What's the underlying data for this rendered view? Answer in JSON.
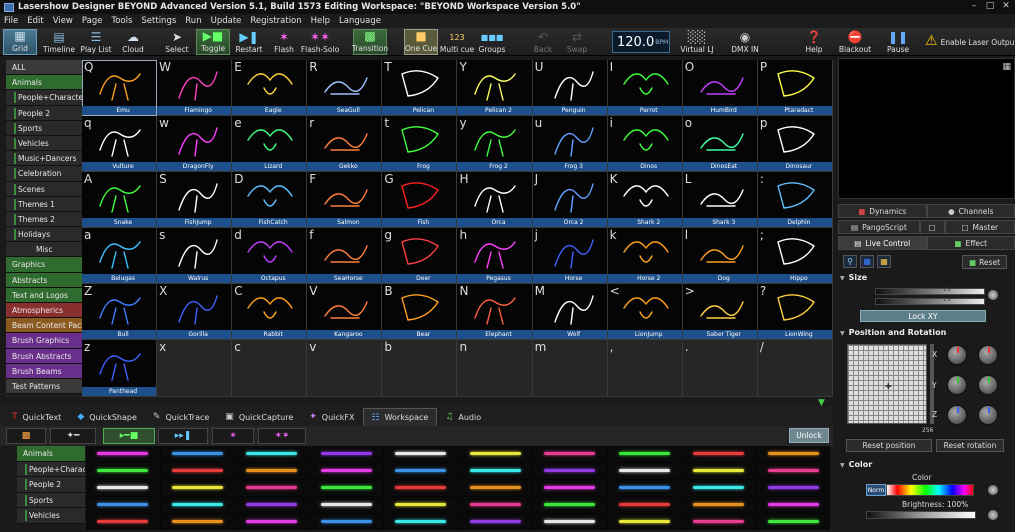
{
  "window": {
    "title": "Lasershow Designer BEYOND Advanced    Version 5.1, Build 1573   Editing Workspace: \"BEYOND Workspace Version 5.0\""
  },
  "menu": [
    "File",
    "Edit",
    "View",
    "Page",
    "Tools",
    "Settings",
    "Run",
    "Update",
    "Registration",
    "Help",
    "Language"
  ],
  "toolbar": {
    "grid": "Grid",
    "timeline": "Timeline",
    "playlist": "Play List",
    "cloud": "Cloud",
    "select": "Select",
    "toggle": "Toggle",
    "restart": "Restart",
    "flash": "Flash",
    "flash_solo": "Flash-Solo",
    "transition": "Transition",
    "one_cue": "One Cue",
    "multi_cue": "Multi cue",
    "groups": "Groups",
    "back": "Back",
    "swap": "Swap",
    "bpm_value": "120.0",
    "bpm_unit": "BPM",
    "virtual_lj": "Virtual LJ",
    "dmx_in": "DMX IN",
    "help": "Help",
    "blackout": "Blackout",
    "pause": "Pause",
    "enable_laser": "Enable Laser Output"
  },
  "categories": [
    {
      "label": "ALL",
      "level": 0,
      "color": "#3a3a3a"
    },
    {
      "label": "Animals",
      "level": 0,
      "color": "#2f6a2f"
    },
    {
      "label": "People+Characters",
      "level": 1
    },
    {
      "label": "People 2",
      "level": 1
    },
    {
      "label": "Sports",
      "level": 1
    },
    {
      "label": "Vehicles",
      "level": 1
    },
    {
      "label": "Music+Dancers",
      "level": 1
    },
    {
      "label": "Celebration",
      "level": 1
    },
    {
      "label": "Scenes",
      "level": 1
    },
    {
      "label": "Themes 1",
      "level": 1
    },
    {
      "label": "Themes 2",
      "level": 1
    },
    {
      "label": "Holidays",
      "level": 1
    },
    {
      "label": "Misc",
      "level": 2
    },
    {
      "label": "Graphics",
      "level": 0,
      "color": "#2f6a2f"
    },
    {
      "label": "Abstracts",
      "level": 0,
      "color": "#2f6a2f"
    },
    {
      "label": "Text and Logos",
      "level": 0,
      "color": "#2f6a2f"
    },
    {
      "label": "Atmospherics",
      "level": 0,
      "color": "#8a2f2f"
    },
    {
      "label": "Beam Content Pack",
      "level": 0,
      "color": "#8a5a1f"
    },
    {
      "label": "Brush Graphics",
      "level": 0,
      "color": "#6a2f8a"
    },
    {
      "label": "Brush Abstracts",
      "level": 0,
      "color": "#6a2f8a"
    },
    {
      "label": "Brush Beams",
      "level": 0,
      "color": "#6a2f8a"
    },
    {
      "label": "Test Patterns",
      "level": 0,
      "color": "#3a3a3a"
    }
  ],
  "cues": [
    {
      "key": "Q",
      "name": "Emu",
      "c": "#ffa020"
    },
    {
      "key": "W",
      "name": "Flamingo",
      "c": "#ff40c0"
    },
    {
      "key": "E",
      "name": "Eagle",
      "c": "#ffd040"
    },
    {
      "key": "R",
      "name": "SeaGull",
      "c": "#a0c0ff"
    },
    {
      "key": "T",
      "name": "Pelican",
      "c": "#ffffff"
    },
    {
      "key": "Y",
      "name": "Pelican 2",
      "c": "#ffff60"
    },
    {
      "key": "U",
      "name": "Penguin",
      "c": "#ffffff"
    },
    {
      "key": "I",
      "name": "Parrot",
      "c": "#40ff40"
    },
    {
      "key": "O",
      "name": "HumBird",
      "c": "#c040ff"
    },
    {
      "key": "P",
      "name": "Ptaradact",
      "c": "#ffff40"
    },
    {
      "key": "q",
      "name": "Vulture",
      "c": "#ffffff"
    },
    {
      "key": "w",
      "name": "DragonFly",
      "c": "#ff40ff"
    },
    {
      "key": "e",
      "name": "Lizard",
      "c": "#40ff80"
    },
    {
      "key": "r",
      "name": "Gekko",
      "c": "#ff8040"
    },
    {
      "key": "t",
      "name": "Frog",
      "c": "#40ff40"
    },
    {
      "key": "y",
      "name": "Frog 2",
      "c": "#40ff40"
    },
    {
      "key": "u",
      "name": "Frog 3",
      "c": "#60a0ff"
    },
    {
      "key": "i",
      "name": "Dinos",
      "c": "#40ff40"
    },
    {
      "key": "o",
      "name": "DinosEat",
      "c": "#40ffa0"
    },
    {
      "key": "p",
      "name": "Dinosaur",
      "c": "#ffffff"
    },
    {
      "key": "A",
      "name": "Snake",
      "c": "#40ff40"
    },
    {
      "key": "S",
      "name": "FishJump",
      "c": "#ffffff"
    },
    {
      "key": "D",
      "name": "FishCatch",
      "c": "#60c0ff"
    },
    {
      "key": "F",
      "name": "Salmon",
      "c": "#ff8040"
    },
    {
      "key": "G",
      "name": "Fish",
      "c": "#ff2020"
    },
    {
      "key": "H",
      "name": "Orca",
      "c": "#ffffff"
    },
    {
      "key": "J",
      "name": "Orca 2",
      "c": "#60a0ff"
    },
    {
      "key": "K",
      "name": "Shark 2",
      "c": "#ffffff"
    },
    {
      "key": "L",
      "name": "Shark 3",
      "c": "#ffffff"
    },
    {
      "key": ":",
      "name": "Delphin",
      "c": "#60c0ff"
    },
    {
      "key": "a",
      "name": "Belugas",
      "c": "#40c0ff"
    },
    {
      "key": "s",
      "name": "Walrus",
      "c": "#ffffff"
    },
    {
      "key": "d",
      "name": "Octapus",
      "c": "#c040ff"
    },
    {
      "key": "f",
      "name": "SeaHorse",
      "c": "#ff8040"
    },
    {
      "key": "g",
      "name": "Deer",
      "c": "#ff4040"
    },
    {
      "key": "h",
      "name": "Pegasus",
      "c": "#ff40ff"
    },
    {
      "key": "j",
      "name": "Horse",
      "c": "#4060ff"
    },
    {
      "key": "k",
      "name": "Horse 2",
      "c": "#ffa020"
    },
    {
      "key": "l",
      "name": "Dog",
      "c": "#ffa020"
    },
    {
      "key": ";",
      "name": "Hippo",
      "c": "#ffffff"
    },
    {
      "key": "Z",
      "name": "Bull",
      "c": "#4080ff"
    },
    {
      "key": "X",
      "name": "Gorilla",
      "c": "#4060ff"
    },
    {
      "key": "C",
      "name": "Rabbit",
      "c": "#ffa020"
    },
    {
      "key": "V",
      "name": "Kangaroo",
      "c": "#ff8040"
    },
    {
      "key": "B",
      "name": "Bear",
      "c": "#ffa020"
    },
    {
      "key": "N",
      "name": "Elephant",
      "c": "#ff6040"
    },
    {
      "key": "M",
      "name": "Wolf",
      "c": "#ffffff"
    },
    {
      "key": "<",
      "name": "LionJump",
      "c": "#ffa020"
    },
    {
      "key": ">",
      "name": "Saber Tiger",
      "c": "#ffd040"
    },
    {
      "key": "?",
      "name": "LionWing",
      "c": "#ffd040"
    },
    {
      "key": "z",
      "name": "Panthead",
      "c": "#4060ff"
    },
    {
      "key": "x",
      "name": "",
      "c": ""
    },
    {
      "key": "c",
      "name": "",
      "c": ""
    },
    {
      "key": "v",
      "name": "",
      "c": ""
    },
    {
      "key": "b",
      "name": "",
      "c": ""
    },
    {
      "key": "n",
      "name": "",
      "c": ""
    },
    {
      "key": "m",
      "name": "",
      "c": ""
    },
    {
      "key": ",",
      "name": "",
      "c": ""
    },
    {
      "key": ".",
      "name": "",
      "c": ""
    },
    {
      "key": "/",
      "name": "",
      "c": ""
    }
  ],
  "bottom_tabs": [
    {
      "label": "QuickText",
      "icon": "T"
    },
    {
      "label": "QuickShape",
      "icon": "◆"
    },
    {
      "label": "QuickTrace",
      "icon": "✎"
    },
    {
      "label": "QuickCapture",
      "icon": "▣"
    },
    {
      "label": "QuickFX",
      "icon": "✦"
    },
    {
      "label": "Workspace",
      "icon": "☷"
    },
    {
      "label": "Audio",
      "icon": "♫"
    }
  ],
  "bottom_tree": [
    {
      "label": "Animals",
      "level": 0
    },
    {
      "label": "People+Characters",
      "level": 1
    },
    {
      "label": "People 2",
      "level": 1
    },
    {
      "label": "Sports",
      "level": 1
    },
    {
      "label": "Vehicles",
      "level": 1
    }
  ],
  "unlock": "Unlock",
  "workspace_colors": [
    "#ff40ff",
    "#40ff40",
    "#ffffff",
    "#40a0ff",
    "#ff4040",
    "#ffff40",
    "#40ffff",
    "#ffa020",
    "#ff40a0",
    "#a040ff"
  ],
  "right": {
    "tabs_row1": [
      "Dynamics",
      "Channels"
    ],
    "tabs_row2": [
      "PangoScript",
      "",
      "Master"
    ],
    "tabs_row3": [
      "Live Control",
      "Effect"
    ],
    "reset": "Reset",
    "size": "Size",
    "size_value_a": "1.0",
    "size_value_b": "1.0",
    "lock_xy": "Lock XY",
    "position_rotation": "Position and Rotation",
    "axis_x": "X",
    "axis_y": "Y",
    "axis_z": "Z",
    "zoom_value": "256",
    "reset_position": "Reset position",
    "reset_rotation": "Reset rotation",
    "color_section": "Color",
    "color_label": "Color",
    "norm": "Norm",
    "brightness": "Brightness: 100%"
  }
}
